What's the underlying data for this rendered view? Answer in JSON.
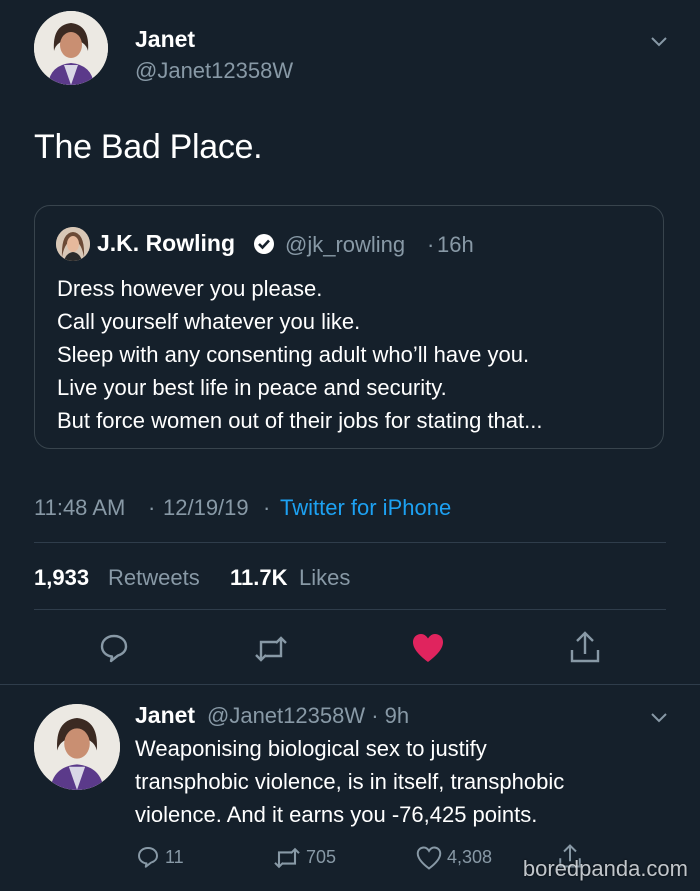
{
  "tweet": {
    "author_name": "Janet",
    "author_handle": "@Janet12358W",
    "text": "The Bad Place.",
    "time": "11:48 AM",
    "date": "12/19/19",
    "source": "Twitter for iPhone",
    "retweets_count": "1,933",
    "retweets_label": "Retweets",
    "likes_count": "11.7K",
    "likes_label": "Likes"
  },
  "quoted": {
    "name": "J.K. Rowling",
    "handle": "@jk_rowling",
    "age": "16h",
    "lines": [
      "Dress however you please.",
      "Call yourself whatever you like.",
      "Sleep with any consenting adult who’ll have you.",
      "Live your best life in peace and security.",
      "But force women out of their jobs for stating that..."
    ]
  },
  "reply": {
    "author_name": "Janet",
    "handle_age": "@Janet12358W · 9h",
    "lines": [
      "Weaponising biological sex to justify",
      "transphobic violence, is in itself, transphobic",
      "violence. And it earns you -76,425 points."
    ],
    "replies": "11",
    "retweets": "705",
    "likes": "4,308"
  },
  "separator": "·",
  "watermark": "boredpanda.com",
  "colors": {
    "background": "#15202b",
    "muted": "#8899a6",
    "link": "#1da1f2",
    "like": "#e0245e",
    "divider": "#2f3d4b"
  },
  "icons": [
    "chevron-down-icon",
    "verified-badge-icon",
    "reply-icon",
    "retweet-icon",
    "heart-filled-icon",
    "share-icon",
    "heart-outline-icon"
  ]
}
